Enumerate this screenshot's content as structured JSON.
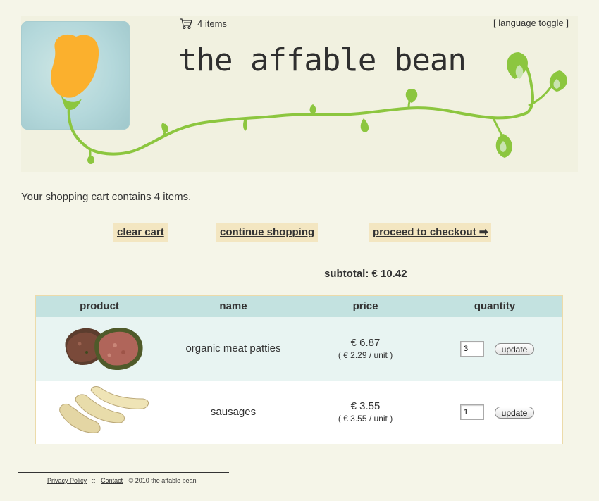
{
  "header": {
    "cart_count_text": "4 items",
    "language_toggle": "[ language toggle ]",
    "site_title": "the affable bean"
  },
  "cart": {
    "summary": "Your shopping cart contains 4 items.",
    "actions": {
      "clear": "clear cart",
      "continue": "continue shopping",
      "checkout": "proceed to checkout ➡"
    },
    "subtotal": "subtotal: € 10.42",
    "columns": [
      "product",
      "name",
      "price",
      "quantity"
    ],
    "items": [
      {
        "name": "organic meat patties",
        "price": "€ 6.87",
        "unit_price": "( € 2.29 / unit )",
        "quantity": "3",
        "update_label": "update",
        "image_icon": "meat-patties-image"
      },
      {
        "name": "sausages",
        "price": "€ 3.55",
        "unit_price": "( € 3.55 / unit )",
        "quantity": "1",
        "update_label": "update",
        "image_icon": "sausages-image"
      }
    ]
  },
  "footer": {
    "privacy": "Privacy Policy",
    "separator": "::",
    "contact": "Contact",
    "copyright": "©   2010 the affable bean"
  },
  "colors": {
    "background": "#f5f5e8",
    "vine_green": "#8cc63f",
    "bean_orange": "#fbb02d",
    "table_header": "#c3e2e0",
    "button_bg": "#f3e6c1"
  }
}
